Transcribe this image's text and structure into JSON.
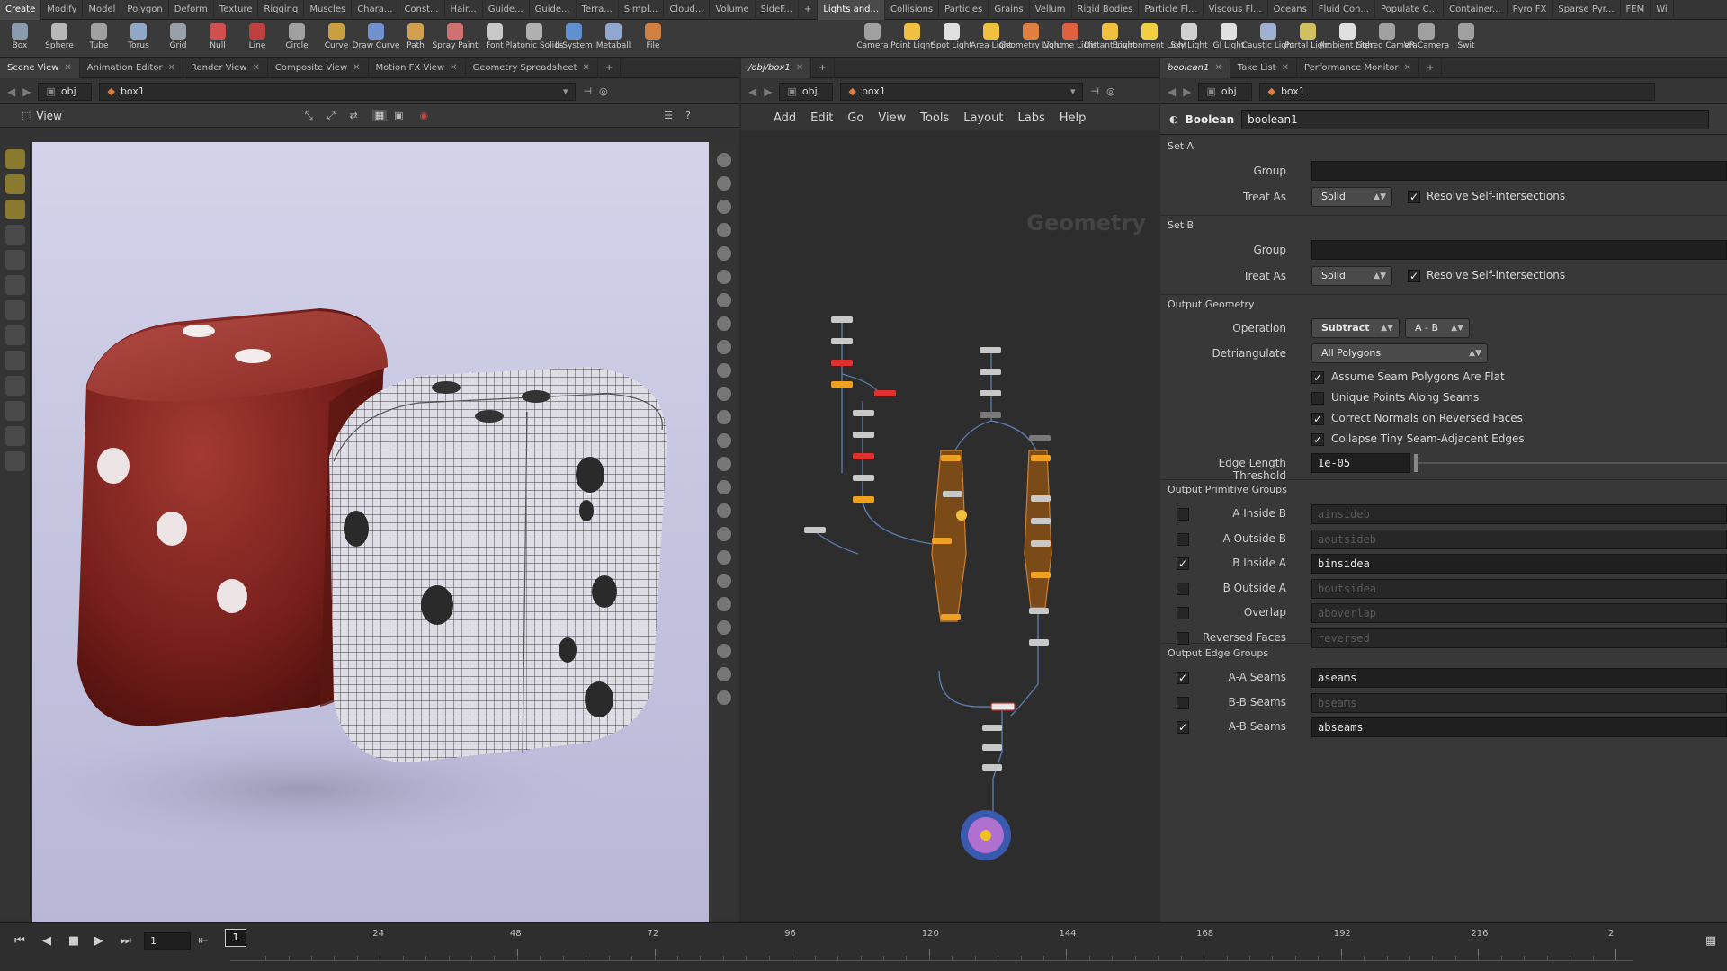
{
  "shelf_tabs": [
    "Create",
    "Modify",
    "Model",
    "Polygon",
    "Deform",
    "Texture",
    "Rigging",
    "Muscles",
    "Chara...",
    "Const...",
    "Hair...",
    "Guide...",
    "Guide...",
    "Terra...",
    "Simpl...",
    "Cloud...",
    "Volume",
    "SideF...",
    "+",
    "Lights and...",
    "Collisions",
    "Particles",
    "Grains",
    "Vellum",
    "Rigid Bodies",
    "Particle Fl...",
    "Viscous Fl...",
    "Oceans",
    "Fluid Con...",
    "Populate C...",
    "Container...",
    "Pyro FX",
    "Sparse Pyr...",
    "FEM",
    "Wi"
  ],
  "create_tools": [
    {
      "label": "Box",
      "icon": "box-icon",
      "color": "#8a9bb0"
    },
    {
      "label": "Sphere",
      "icon": "sphere-icon",
      "color": "#b8b8b8"
    },
    {
      "label": "Tube",
      "icon": "tube-icon",
      "color": "#a0a0a0"
    },
    {
      "label": "Torus",
      "icon": "torus-icon",
      "color": "#8fa8c8"
    },
    {
      "label": "Grid",
      "icon": "grid-icon",
      "color": "#9aa0a8"
    },
    {
      "label": "Null",
      "icon": "null-icon",
      "color": "#d05050"
    },
    {
      "label": "Line",
      "icon": "line-icon",
      "color": "#c04040"
    },
    {
      "label": "Circle",
      "icon": "circle-icon",
      "color": "#a0a0a0"
    },
    {
      "label": "Curve",
      "icon": "curve-icon",
      "color": "#c8a040"
    },
    {
      "label": "Draw Curve",
      "icon": "draw-curve-icon",
      "color": "#7090d0"
    },
    {
      "label": "Path",
      "icon": "path-icon",
      "color": "#d0a050"
    },
    {
      "label": "Spray Paint",
      "icon": "spray-paint-icon",
      "color": "#d07070"
    },
    {
      "label": "Font",
      "icon": "font-icon",
      "color": "#c8c8c8"
    },
    {
      "label": "Platonic Solids",
      "icon": "platonic-solids-icon",
      "color": "#b0b0b0"
    },
    {
      "label": "L-System",
      "icon": "l-system-icon",
      "color": "#6090d0"
    },
    {
      "label": "Metaball",
      "icon": "metaball-icon",
      "color": "#90a8d0"
    },
    {
      "label": "File",
      "icon": "file-icon",
      "color": "#d08040"
    }
  ],
  "light_tools": [
    {
      "label": "Camera",
      "icon": "camera-icon",
      "color": "#a0a0a0"
    },
    {
      "label": "Point Light",
      "icon": "point-light-icon",
      "color": "#f0c040"
    },
    {
      "label": "Spot Light",
      "icon": "spot-light-icon",
      "color": "#e0e0e0"
    },
    {
      "label": "Area Light",
      "icon": "area-light-icon",
      "color": "#f0c040"
    },
    {
      "label": "Geometry Light",
      "icon": "geometry-light-icon",
      "color": "#e08040"
    },
    {
      "label": "Volume Light",
      "icon": "volume-light-icon",
      "color": "#e06040"
    },
    {
      "label": "Distant Light",
      "icon": "distant-light-icon",
      "color": "#f0c040"
    },
    {
      "label": "Environment Light",
      "icon": "environment-light-icon",
      "color": "#f0d040"
    },
    {
      "label": "Sky Light",
      "icon": "sky-light-icon",
      "color": "#d0d0d0"
    },
    {
      "label": "GI Light",
      "icon": "gi-light-icon",
      "color": "#e0e0e0"
    },
    {
      "label": "Caustic Light",
      "icon": "caustic-light-icon",
      "color": "#a0b0d0"
    },
    {
      "label": "Portal Light",
      "icon": "portal-light-icon",
      "color": "#d0c060"
    },
    {
      "label": "Ambient Light",
      "icon": "ambient-light-icon",
      "color": "#e0e0e0"
    },
    {
      "label": "Stereo Camera",
      "icon": "stereo-camera-icon",
      "color": "#a0a0a0"
    },
    {
      "label": "VR Camera",
      "icon": "vr-camera-icon",
      "color": "#a0a0a0"
    },
    {
      "label": "Swit",
      "icon": "switcher-icon",
      "color": "#a0a0a0"
    }
  ],
  "left_panel": {
    "tabs": [
      "Scene View",
      "Animation Editor",
      "Render View",
      "Composite View",
      "Motion FX View",
      "Geometry Spreadsheet"
    ],
    "path_obj": "obj",
    "path_node": "box1",
    "view_label": "View"
  },
  "mid_panel": {
    "tab": "/obj/box1",
    "path_obj": "obj",
    "path_node": "box1",
    "menus": [
      "Add",
      "Edit",
      "Go",
      "View",
      "Tools",
      "Layout",
      "Labs",
      "Help"
    ],
    "context_label": "Geometry"
  },
  "right_panel": {
    "tabs": [
      "boolean1",
      "Take List",
      "Performance Monitor"
    ],
    "path_obj": "obj",
    "path_node": "box1",
    "node_type": "Boolean",
    "node_name": "boolean1"
  },
  "params": {
    "set_a": "Set A",
    "set_b": "Set B",
    "group_label": "Group",
    "treat_as_label": "Treat As",
    "treat_as_value": "Solid",
    "resolve_label": "Resolve Self-intersections",
    "output_geometry": "Output Geometry",
    "operation_label": "Operation",
    "operation_value": "Subtract",
    "operation_mode": "A - B",
    "detriangulate_label": "Detriangulate",
    "detriangulate_value": "All Polygons",
    "opt1": "Assume Seam Polygons Are Flat",
    "opt2": "Unique Points Along Seams",
    "opt3": "Correct Normals on Reversed Faces",
    "opt4": "Collapse Tiny Seam-Adjacent Edges",
    "edge_len_label": "Edge Length Threshold",
    "edge_len_value": "1e-05",
    "prim_groups": "Output Primitive Groups",
    "pg": [
      {
        "label": "A Inside B",
        "value": "ainsideb",
        "on": false
      },
      {
        "label": "A Outside B",
        "value": "aoutsideb",
        "on": false
      },
      {
        "label": "B Inside A",
        "value": "binsidea",
        "on": true
      },
      {
        "label": "B Outside A",
        "value": "boutsidea",
        "on": false
      },
      {
        "label": "Overlap",
        "value": "aboverlap",
        "on": false
      },
      {
        "label": "Reversed Faces",
        "value": "reversed",
        "on": false
      }
    ],
    "edge_groups": "Output Edge Groups",
    "eg": [
      {
        "label": "A-A Seams",
        "value": "aseams",
        "on": true
      },
      {
        "label": "B-B Seams",
        "value": "bseams",
        "on": false
      },
      {
        "label": "A-B Seams",
        "value": "abseams",
        "on": true
      }
    ]
  },
  "timeline": {
    "frame": "1",
    "current": "1",
    "ticks": [
      "24",
      "48",
      "72",
      "96",
      "120",
      "144",
      "168",
      "192",
      "216",
      "2"
    ]
  }
}
